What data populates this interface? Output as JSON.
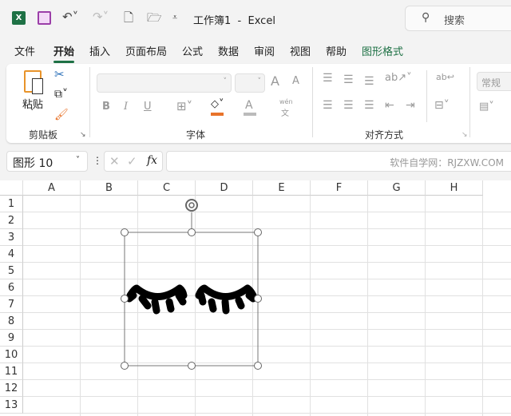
{
  "titlebar": {
    "title": "工作簿1  -  Excel",
    "search_placeholder": "搜索"
  },
  "menu": [
    "文件",
    "开始",
    "插入",
    "页面布局",
    "公式",
    "数据",
    "审阅",
    "视图",
    "帮助",
    "图形格式"
  ],
  "ribbon": {
    "paste": "粘贴",
    "clipboard": "剪贴板",
    "font": "字体",
    "alignment": "对齐方式",
    "number_format": "常规",
    "bold": "B",
    "italic": "I",
    "underline": "U",
    "font_color": "A",
    "wen": "wén",
    "wen2": "文",
    "grow": "A",
    "shrink": "A"
  },
  "formula_bar": {
    "name_box": "图形 10",
    "fx": "fx",
    "value": "软件自学网：RJZXW.COM"
  },
  "sheet": {
    "columns": [
      "A",
      "B",
      "C",
      "D",
      "E",
      "F",
      "G",
      "H"
    ],
    "rows": [
      "1",
      "2",
      "3",
      "4",
      "5",
      "6",
      "7",
      "8",
      "9",
      "10",
      "11",
      "12",
      "13"
    ]
  },
  "colors": {
    "accent": "#1e7145",
    "fill_color": "#e8732a"
  }
}
